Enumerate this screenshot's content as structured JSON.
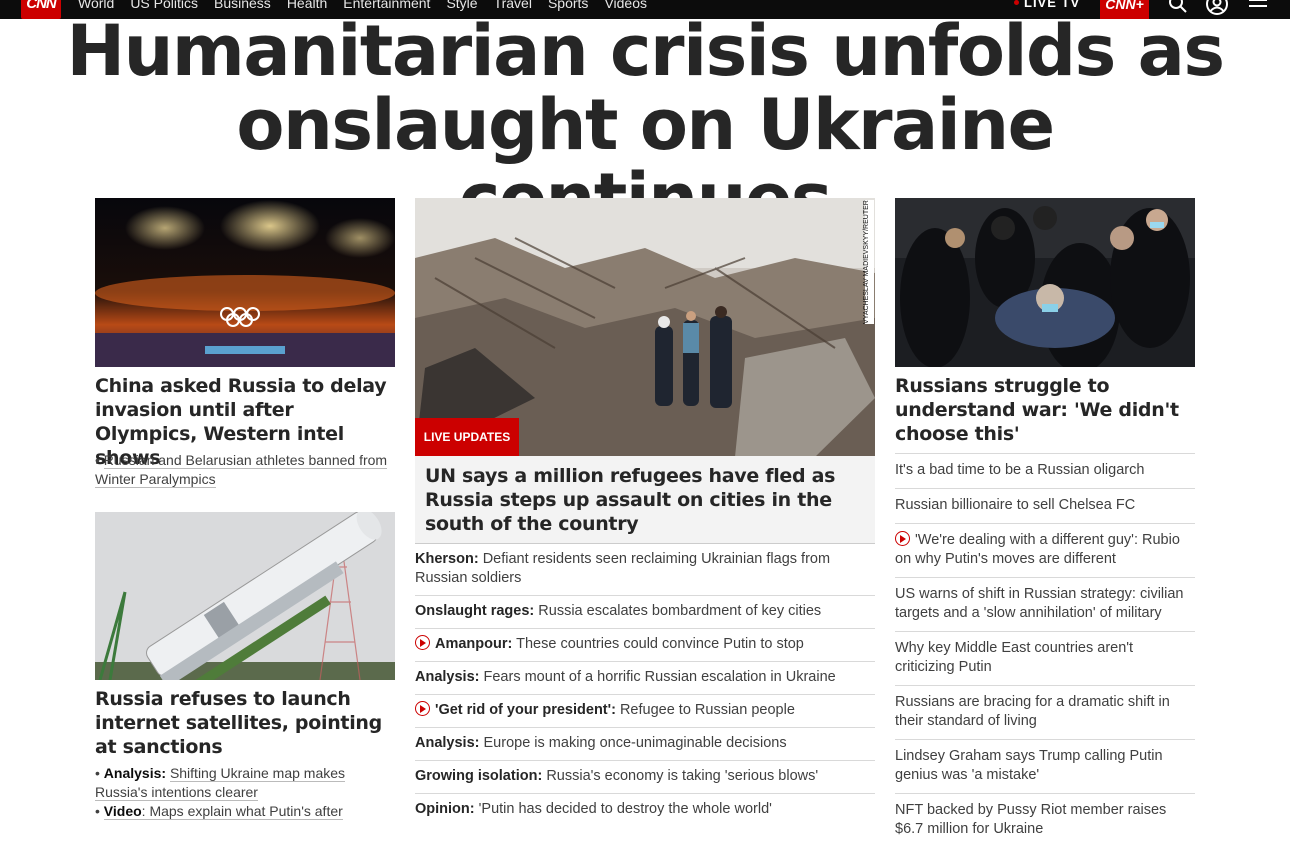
{
  "nav": {
    "logo": "CNN",
    "links": [
      "World",
      "US Politics",
      "Business",
      "Health",
      "Entertainment",
      "Style",
      "Travel",
      "Sports",
      "Videos"
    ],
    "live_tv": "LIVE TV",
    "cnn_plus": "CNN+",
    "icons": [
      "search-icon",
      "account-icon",
      "menu-icon"
    ]
  },
  "headline": "Humanitarian crisis unfolds as onslaught on Ukraine continues",
  "left": {
    "story1": {
      "title": "China asked Russia to delay invasion until after Olympics, Western intel shows",
      "sub": "Russian and Belarusian athletes banned from Winter Paralympics"
    },
    "story2": {
      "title": "Russia refuses to launch internet satellites, pointing at sanctions",
      "sub1_label": "Analysis:",
      "sub1_text": "Shifting Ukraine map makes Russia's intentions clearer",
      "sub2_label": "Video",
      "sub2_text": ": Maps explain what Putin's after"
    }
  },
  "center": {
    "photo_credit": "VYACHESLAV MADIEVSKYY/REUTERS",
    "badge": "LIVE UPDATES",
    "title": "UN says a million refugees have fled as Russia steps up assault on cities in the south of the country",
    "items": [
      {
        "label": "Kherson:",
        "text": "Defiant residents seen reclaiming Ukrainian flags from Russian soldiers",
        "video": false
      },
      {
        "label": "Onslaught rages:",
        "text": "Russia escalates bombardment of key cities",
        "video": false
      },
      {
        "label": "Amanpour:",
        "text": "These countries could convince Putin to stop",
        "video": true
      },
      {
        "label": "Analysis:",
        "text": "Fears mount of a horrific Russian escalation in Ukraine",
        "video": false
      },
      {
        "label": "'Get rid of your president':",
        "text": "Refugee to Russian people",
        "video": true
      },
      {
        "label": "Analysis:",
        "text": "Europe is making once-unimaginable decisions",
        "video": false
      },
      {
        "label": "Growing isolation:",
        "text": "Russia's economy is taking 'serious blows'",
        "video": false
      },
      {
        "label": "Opinion:",
        "text": "'Putin has decided to destroy the whole world'",
        "video": false
      }
    ]
  },
  "right": {
    "title": "Russians struggle to understand war: 'We didn't choose this'",
    "items": [
      {
        "text": "It's a bad time to be a Russian oligarch",
        "video": false
      },
      {
        "text": "Russian billionaire to sell Chelsea FC",
        "video": false
      },
      {
        "text": "'We're dealing with a different guy': Rubio on why Putin's moves are different",
        "video": true
      },
      {
        "text": "US warns of shift in Russian strategy: civilian targets and a 'slow annihilation' of military",
        "video": false
      },
      {
        "text": "Why key Middle East countries aren't criticizing Putin",
        "video": false
      },
      {
        "text": "Russians are bracing for a dramatic shift in their standard of living",
        "video": false
      },
      {
        "text": "Lindsey Graham says Trump calling Putin genius was 'a mistake'",
        "video": false
      },
      {
        "text": "NFT backed by Pussy Riot member raises $6.7 million for Ukraine",
        "video": false
      }
    ]
  }
}
